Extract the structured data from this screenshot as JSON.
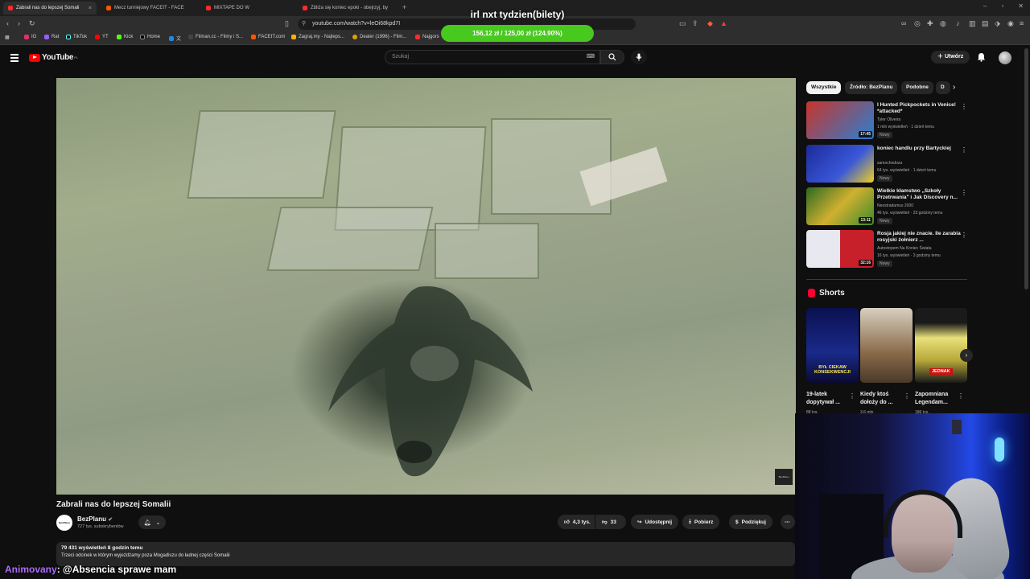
{
  "browser": {
    "tabs": [
      {
        "label": "Zabrali nas do lepszej Somali",
        "active": true
      },
      {
        "label": "Mecz turniejowy FACEIT - FACE",
        "active": false
      },
      {
        "label": "MIXTAPE DO W",
        "active": false
      },
      {
        "label": "Zbliża się koniec epoki - obejrzyj, by",
        "active": false
      }
    ],
    "url": "youtube.com/watch?v=leOi68kpd7I",
    "bookmarks": [
      "IG",
      "Rat",
      "TikTok",
      "YT",
      "Kick",
      "Home",
      "文",
      "Filman.cc - Filmy i S...",
      "FACEIT.com",
      "Zagraj.my - Najleps...",
      "Dealer (1996) - Film...",
      "Najgors"
    ]
  },
  "overlay": {
    "goal_title": "irl nxt tydzien(bilety)",
    "goal_progress": "156,12 zł / 125,00 zł (124.90%)",
    "chat_user": "Animovany",
    "chat_message": ": @Absencia sprawe mam"
  },
  "header": {
    "logo": "YouTube",
    "region": "PL",
    "search_placeholder": "Szukaj",
    "create_label": "Utwórz"
  },
  "video": {
    "title": "Zabrali nas do lepszej Somalii",
    "watermark": "BezPlanu",
    "channel": "BezPlanu",
    "channel_avatar_text": "BezPlanu",
    "subscribers": "727 tys. subskrybentów",
    "likes": "4,3 tys.",
    "dislikes": "33",
    "share_label": "Udostępnij",
    "download_label": "Pobierz",
    "thanks_label": "Podziękuj",
    "views_line": "79 431 wyświetleń  8 godzin temu",
    "description": "Trzeci odcinek w którym wyjeżdżamy poza Mogadiszu do ładnej części Somalii"
  },
  "sidebar": {
    "chips": [
      "Wszystkie",
      "Źródło: BezPlanu",
      "Podobne",
      "D"
    ],
    "recommendations": [
      {
        "title": "I Hunted Pickpockets in Venice! *attacked*",
        "channel": "Tyler Oliveira",
        "meta": "1 mln wyświetleń · 1 dzień temu",
        "badge": "Nowy",
        "duration": "17:45",
        "thumb": "#c8342c"
      },
      {
        "title": "koniec handlu przy Bartyckiej",
        "channel": "samochodoza",
        "meta": "64 tys. wyświetleń · 1 dzień temu",
        "badge": "Nowy",
        "duration": "",
        "thumb": "#2b3ea8"
      },
      {
        "title": "Wielkie kłamstwo „Szkoły Przetrwania\" i Jak Discovery n...",
        "channel": "Neostradamus 2000",
        "meta": "46 tys. wyświetleń · 23 godziny temu",
        "badge": "Nowy",
        "duration": "13:11",
        "thumb": "#3f8a2a"
      },
      {
        "title": "Rosja jakiej nie znacie. Ile zarabia rosyjski żołnierz ...",
        "channel": "Autostopem Na Koniec Świata",
        "meta": "16 tys. wyświetleń · 3 godziny temu",
        "badge": "Nowy",
        "duration": "32:16",
        "thumb": "#c8202a"
      }
    ],
    "shorts_label": "Shorts",
    "shorts": [
      {
        "title": "19-latek dopytywał ...",
        "views": "88 tys.",
        "caption": "BYŁ CIEKAW KONSEKWENCJI",
        "bg": "#1a2a8a"
      },
      {
        "title": "Kiedy ktoś dołoży do ...",
        "views": "3,6 mln",
        "caption": "",
        "bg": "#8a6a4a"
      },
      {
        "title": "Zapomniana Legendam...",
        "views": "186 tys.",
        "caption": "JEDNAK",
        "bg": "#b8a83a"
      }
    ]
  }
}
